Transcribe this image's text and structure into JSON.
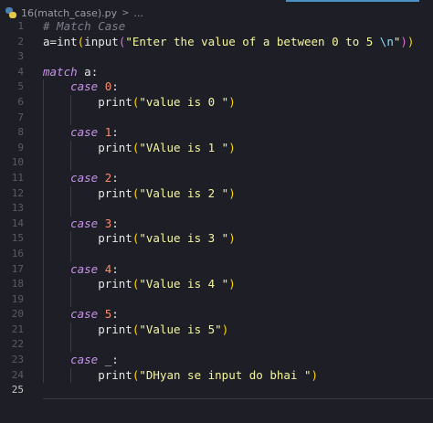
{
  "breadcrumb": {
    "file": "16(match_case).py",
    "separator": ">",
    "more": "..."
  },
  "editor": {
    "active_line": 25,
    "lines": [
      {
        "n": "1",
        "tokens": [
          {
            "t": "# Match Case",
            "c": "comment"
          }
        ]
      },
      {
        "n": "2",
        "tokens": [
          {
            "t": "a",
            "c": "plain"
          },
          {
            "t": "=",
            "c": "plain"
          },
          {
            "t": "int",
            "c": "fn"
          },
          {
            "t": "(",
            "c": "paren1"
          },
          {
            "t": "input",
            "c": "fn"
          },
          {
            "t": "(",
            "c": "paren2"
          },
          {
            "t": "\"Enter the value of a between 0 to 5 ",
            "c": "str"
          },
          {
            "t": "\\n",
            "c": "esc"
          },
          {
            "t": "\"",
            "c": "str"
          },
          {
            "t": ")",
            "c": "paren2"
          },
          {
            "t": ")",
            "c": "paren1"
          }
        ]
      },
      {
        "n": "3",
        "tokens": []
      },
      {
        "n": "4",
        "tokens": [
          {
            "t": "match",
            "c": "kw"
          },
          {
            "t": " a:",
            "c": "plain"
          }
        ]
      },
      {
        "n": "5",
        "tokens": [
          {
            "t": "    ",
            "c": "plain"
          },
          {
            "t": "case",
            "c": "kw"
          },
          {
            "t": " ",
            "c": "plain"
          },
          {
            "t": "0",
            "c": "num"
          },
          {
            "t": ":",
            "c": "plain"
          }
        ]
      },
      {
        "n": "6",
        "tokens": [
          {
            "t": "        print",
            "c": "fn"
          },
          {
            "t": "(",
            "c": "paren1"
          },
          {
            "t": "\"value is 0 \"",
            "c": "str"
          },
          {
            "t": ")",
            "c": "paren1"
          }
        ]
      },
      {
        "n": "7",
        "tokens": []
      },
      {
        "n": "8",
        "tokens": [
          {
            "t": "    ",
            "c": "plain"
          },
          {
            "t": "case",
            "c": "kw"
          },
          {
            "t": " ",
            "c": "plain"
          },
          {
            "t": "1",
            "c": "num"
          },
          {
            "t": ":",
            "c": "plain"
          }
        ]
      },
      {
        "n": "9",
        "tokens": [
          {
            "t": "        print",
            "c": "fn"
          },
          {
            "t": "(",
            "c": "paren1"
          },
          {
            "t": "\"VAlue is 1 \"",
            "c": "str"
          },
          {
            "t": ")",
            "c": "paren1"
          }
        ]
      },
      {
        "n": "10",
        "tokens": []
      },
      {
        "n": "11",
        "tokens": [
          {
            "t": "    ",
            "c": "plain"
          },
          {
            "t": "case",
            "c": "kw"
          },
          {
            "t": " ",
            "c": "plain"
          },
          {
            "t": "2",
            "c": "num"
          },
          {
            "t": ":",
            "c": "plain"
          }
        ]
      },
      {
        "n": "12",
        "tokens": [
          {
            "t": "        print",
            "c": "fn"
          },
          {
            "t": "(",
            "c": "paren1"
          },
          {
            "t": "\"Value is 2 \"",
            "c": "str"
          },
          {
            "t": ")",
            "c": "paren1"
          }
        ]
      },
      {
        "n": "13",
        "tokens": []
      },
      {
        "n": "14",
        "tokens": [
          {
            "t": "    ",
            "c": "plain"
          },
          {
            "t": "case",
            "c": "kw"
          },
          {
            "t": " ",
            "c": "plain"
          },
          {
            "t": "3",
            "c": "num"
          },
          {
            "t": ":",
            "c": "plain"
          }
        ]
      },
      {
        "n": "15",
        "tokens": [
          {
            "t": "        print",
            "c": "fn"
          },
          {
            "t": "(",
            "c": "paren1"
          },
          {
            "t": "\"value is 3 \"",
            "c": "str"
          },
          {
            "t": ")",
            "c": "paren1"
          }
        ]
      },
      {
        "n": "16",
        "tokens": []
      },
      {
        "n": "17",
        "tokens": [
          {
            "t": "    ",
            "c": "plain"
          },
          {
            "t": "case",
            "c": "kw"
          },
          {
            "t": " ",
            "c": "plain"
          },
          {
            "t": "4",
            "c": "num"
          },
          {
            "t": ":",
            "c": "plain"
          }
        ]
      },
      {
        "n": "18",
        "tokens": [
          {
            "t": "        print",
            "c": "fn"
          },
          {
            "t": "(",
            "c": "paren1"
          },
          {
            "t": "\"Value is 4 \"",
            "c": "str"
          },
          {
            "t": ")",
            "c": "paren1"
          }
        ]
      },
      {
        "n": "19",
        "tokens": []
      },
      {
        "n": "20",
        "tokens": [
          {
            "t": "    ",
            "c": "plain"
          },
          {
            "t": "case",
            "c": "kw"
          },
          {
            "t": " ",
            "c": "plain"
          },
          {
            "t": "5",
            "c": "num"
          },
          {
            "t": ":",
            "c": "plain"
          }
        ]
      },
      {
        "n": "21",
        "tokens": [
          {
            "t": "        print",
            "c": "fn"
          },
          {
            "t": "(",
            "c": "paren1"
          },
          {
            "t": "\"Value is 5\"",
            "c": "str"
          },
          {
            "t": ")",
            "c": "paren1"
          }
        ]
      },
      {
        "n": "22",
        "tokens": []
      },
      {
        "n": "23",
        "tokens": [
          {
            "t": "    ",
            "c": "plain"
          },
          {
            "t": "case",
            "c": "kw"
          },
          {
            "t": " _:",
            "c": "plain"
          }
        ]
      },
      {
        "n": "24",
        "tokens": [
          {
            "t": "        print",
            "c": "fn"
          },
          {
            "t": "(",
            "c": "paren1"
          },
          {
            "t": "\"DHyan se input do bhai \"",
            "c": "str"
          },
          {
            "t": ")",
            "c": "paren1"
          }
        ]
      },
      {
        "n": "25",
        "tokens": []
      }
    ]
  },
  "colors": {
    "background": "#1e1f26",
    "comment": "#7c7f8a",
    "keyword": "#c792ea",
    "string": "#f5f5a0",
    "number": "#f78c6c",
    "accent": "#4a90c2"
  }
}
